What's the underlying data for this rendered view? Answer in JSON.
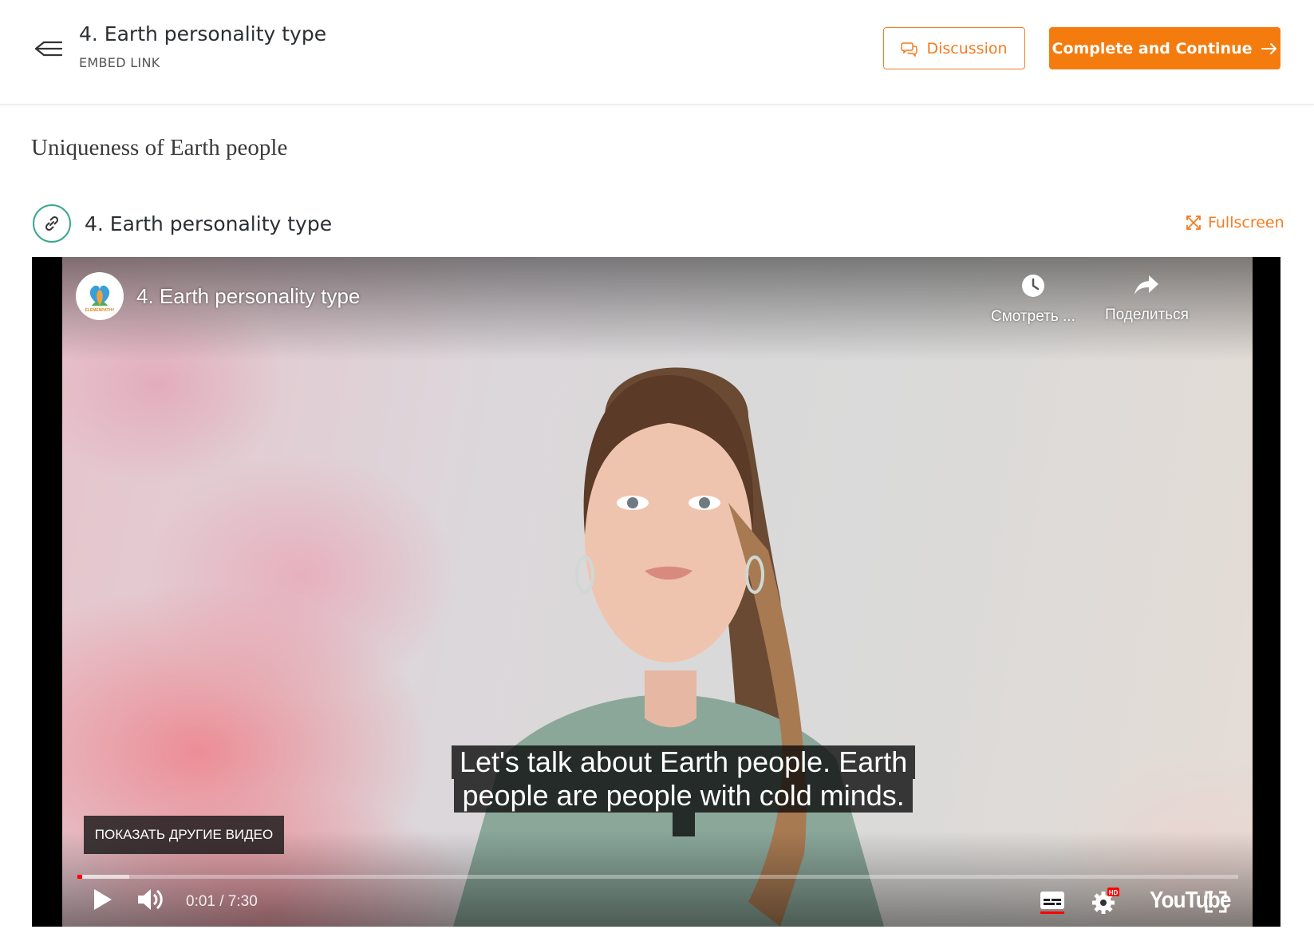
{
  "header": {
    "title": "4. Earth personality type",
    "subtitle": "EMBED LINK",
    "discussion_label": "Discussion",
    "complete_label": "Complete and Continue"
  },
  "section": {
    "heading": "Uniqueness of Earth people"
  },
  "embed": {
    "title": "4. Earth personality type",
    "fullscreen_label": "Fullscreen"
  },
  "video": {
    "title": "4. Earth personality type",
    "channel_logo_text": "ELEMENPATHY",
    "watch_later_label": "Смотреть ...",
    "share_label": "Поделиться",
    "caption_line1": "Let's talk about Earth people. Earth",
    "caption_line2": "people are people with cold minds.",
    "more_videos_label": "ПОКАЗАТЬ ДРУГИЕ ВИДЕО",
    "time_display": "0:01 / 7:30",
    "played_fraction": 0.004,
    "loaded_fraction": 0.045,
    "youtube_label": "YouTube",
    "hd_badge": "HD"
  },
  "colors": {
    "accent": "#f47c20",
    "embed_icon": "#3aa78f",
    "progress_played": "#ff0000"
  }
}
